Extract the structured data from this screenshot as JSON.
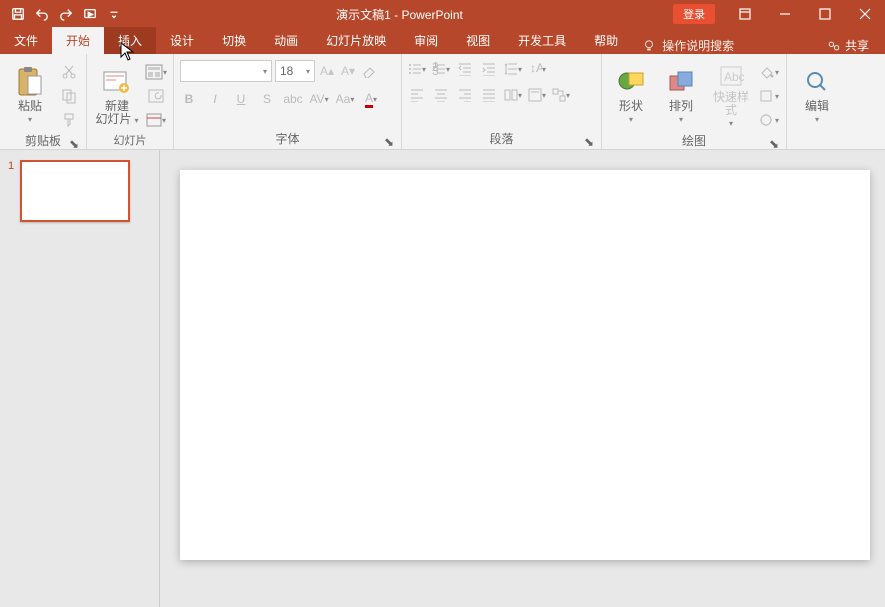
{
  "title": "演示文稿1 - PowerPoint",
  "login": "登录",
  "tabs": {
    "file": "文件",
    "home": "开始",
    "insert": "插入",
    "design": "设计",
    "transitions": "切换",
    "animations": "动画",
    "slideshow": "幻灯片放映",
    "review": "审阅",
    "view": "视图",
    "developer": "开发工具",
    "help": "帮助"
  },
  "tellme": "操作说明搜索",
  "share": "共享",
  "groups": {
    "clipboard": {
      "paste": "粘贴",
      "label": "剪贴板"
    },
    "slides": {
      "new": "新建\n幻灯片",
      "label": "幻灯片"
    },
    "font": {
      "label": "字体",
      "size": "18"
    },
    "paragraph": {
      "label": "段落"
    },
    "drawing": {
      "shapes": "形状",
      "arrange": "排列",
      "quickstyles": "快速样式",
      "label": "绘图"
    },
    "editing": {
      "edit": "编辑"
    }
  },
  "slide_number": "1"
}
